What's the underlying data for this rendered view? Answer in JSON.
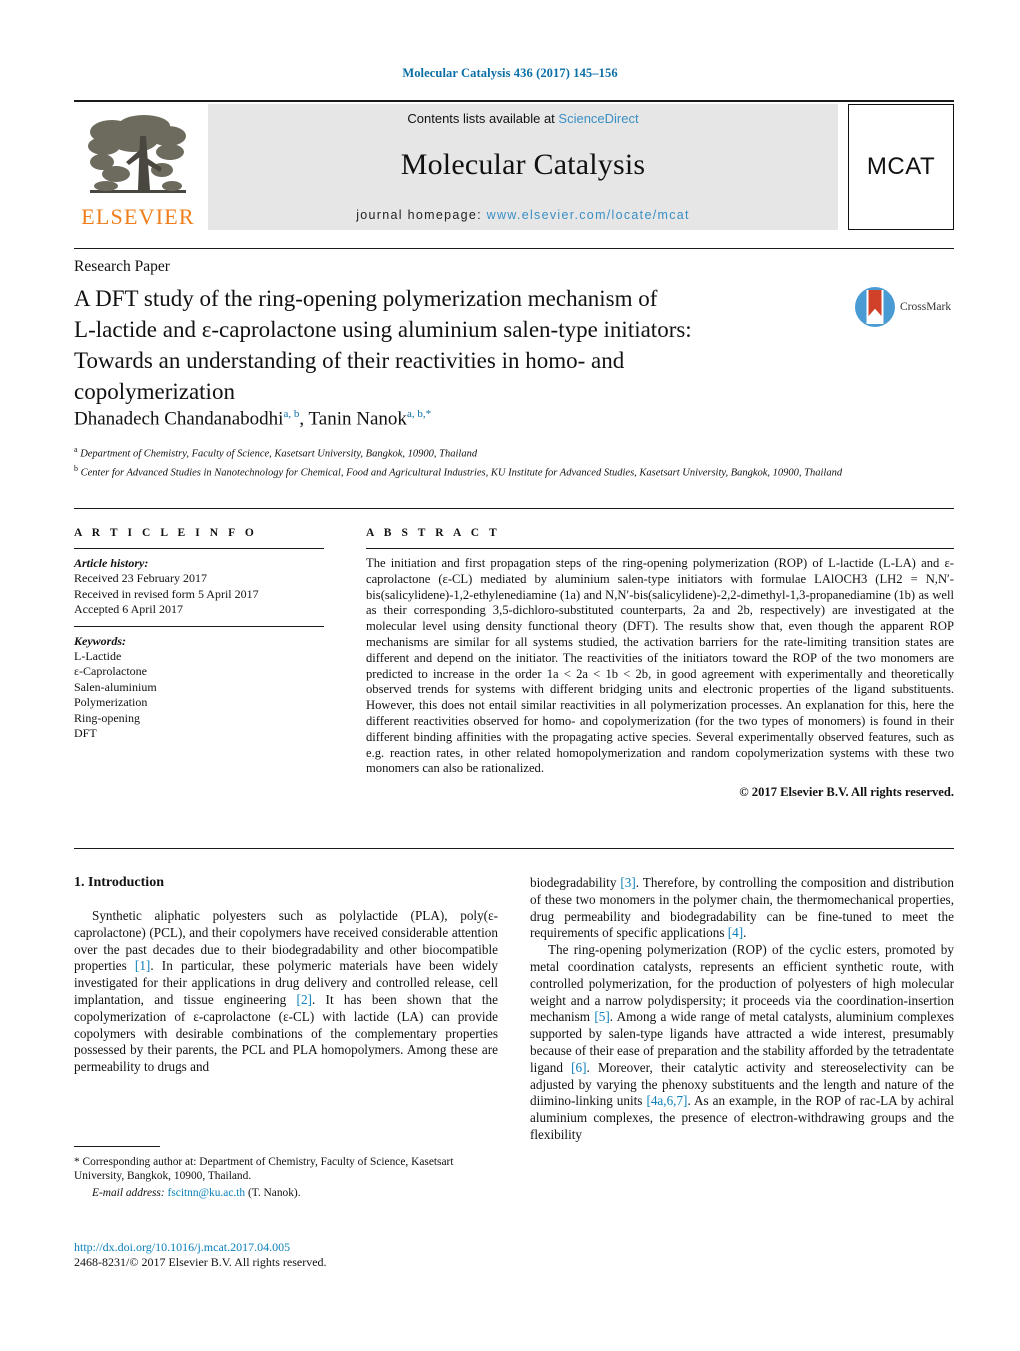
{
  "running_head": "Molecular Catalysis 436 (2017) 145–156",
  "masthead": {
    "contents_prefix": "Contents lists available at ",
    "contents_link": "ScienceDirect",
    "journal_title": "Molecular Catalysis",
    "homepage_prefix": "journal homepage: ",
    "homepage_url": "www.elsevier.com/locate/mcat",
    "publisher_wordmark": "ELSEVIER",
    "journal_badge": "MCAT"
  },
  "article": {
    "type": "Research Paper",
    "title_line1": "A DFT study of the ring-opening polymerization mechanism of",
    "title_line2_a": "L",
    "title_line2_b": "-lactide and ε-caprolactone using aluminium salen-type initiators:",
    "title_line3": "Towards an understanding of their reactivities in homo- and",
    "title_line4": "copolymerization",
    "crossmark_label": "CrossMark",
    "author1": "Dhanadech Chandanabodhi",
    "author1_sup": "a, b",
    "author_sep": ", ",
    "author2": "Tanin Nanok",
    "author2_sup": "a, b,",
    "author2_star": "*",
    "affiliation_a_marker": "a",
    "affiliation_a": "Department of Chemistry, Faculty of Science, Kasetsart University, Bangkok, 10900, Thailand",
    "affiliation_b_marker": "b",
    "affiliation_b": "Center for Advanced Studies in Nanotechnology for Chemical, Food and Agricultural Industries, KU Institute for Advanced Studies, Kasetsart University, Bangkok, 10900, Thailand"
  },
  "article_info": {
    "heading": "A R T I C L E   I N F O",
    "history_label": "Article history:",
    "history": [
      "Received 23 February 2017",
      "Received in revised form 5 April 2017",
      "Accepted 6 April 2017"
    ],
    "keywords_label": "Keywords:",
    "keywords": [
      "L-Lactide",
      "ε-Caprolactone",
      "Salen-aluminium",
      "Polymerization",
      "Ring-opening",
      "DFT"
    ]
  },
  "abstract": {
    "heading": "A B S T R A C T",
    "body": "The initiation and first propagation steps of the ring-opening polymerization (ROP) of L-lactide (L-LA) and ε-caprolactone (ε-CL) mediated by aluminium salen-type initiators with formulae LAlOCH3 (LH2 = N,N′-bis(salicylidene)-1,2-ethylenediamine (1a) and N,N′-bis(salicylidene)-2,2-dimethyl-1,3-propanediamine (1b) as well as their corresponding 3,5-dichloro-substituted counterparts, 2a and 2b, respectively) are investigated at the molecular level using density functional theory (DFT). The results show that, even though the apparent ROP mechanisms are similar for all systems studied, the activation barriers for the rate-limiting transition states are different and depend on the initiator. The reactivities of the initiators toward the ROP of the two monomers are predicted to increase in the order 1a < 2a < 1b < 2b, in good agreement with experimentally and theoretically observed trends for systems with different bridging units and electronic properties of the ligand substituents. However, this does not entail similar reactivities in all polymerization processes. An explanation for this, here the different reactivities observed for homo- and copolymerization (for the two types of monomers) is found in their different binding affinities with the propagating active species. Several experimentally observed features, such as e.g. reaction rates, in other related homopolymerization and random copolymerization systems with these two monomers can also be rationalized.",
    "copyright": "© 2017 Elsevier B.V. All rights reserved."
  },
  "introduction": {
    "heading": "1.  Introduction",
    "left_para1": "Synthetic aliphatic polyesters such as polylactide (PLA), poly(ε-caprolactone) (PCL), and their copolymers have received considerable attention over the past decades due to their biodegradability and other biocompatible properties [1]. In particular, these polymeric materials have been widely investigated for their applications in drug delivery and controlled release, cell implantation, and tissue engineering [2]. It has been shown that the copolymerization of ε-caprolactone (ε-CL) with lactide (LA) can provide copolymers with desirable combinations of the complementary properties possessed by their parents, the PCL and PLA homopolymers. Among these are permeability to drugs and",
    "right_para1": "biodegradability [3]. Therefore, by controlling the composition and distribution of these two monomers in the polymer chain, the thermomechanical properties, drug permeability and biodegradability can be fine-tuned to meet the requirements of specific applications [4].",
    "right_para2": "The ring-opening polymerization (ROP) of the cyclic esters, promoted by metal coordination catalysts, represents an efficient synthetic route, with controlled polymerization, for the production of polyesters of high molecular weight and a narrow polydispersity; it proceeds via the coordination-insertion mechanism [5]. Among a wide range of metal catalysts, aluminium complexes supported by salen-type ligands have attracted a wide interest, presumably because of their ease of preparation and the stability afforded by the tetradentate ligand [6]. Moreover, their catalytic activity and stereoselectivity can be adjusted by varying the phenoxy substituents and the length and nature of the diimino-linking units [4a,6,7]. As an example, in the ROP of rac-LA by achiral aluminium complexes, the presence of electron-withdrawing groups and the flexibility"
  },
  "footer": {
    "corresponding_star": "*",
    "corresponding_text": " Corresponding author at: Department of Chemistry, Faculty of Science, Kasetsart University, Bangkok, 10900, Thailand.",
    "email_label": "E-mail address:",
    "email": "fscitnn@ku.ac.th",
    "email_owner": " (T. Nanok).",
    "doi": "http://dx.doi.org/10.1016/j.mcat.2017.04.005",
    "issn_line": "2468-8231/© 2017 Elsevier B.V. All rights reserved."
  },
  "colors": {
    "link_blue": "#0a7fb8",
    "journal_blue": "#0a6ea6",
    "elsevier_orange": "#ef7d1a",
    "band_gray": "#e6e6e6"
  }
}
